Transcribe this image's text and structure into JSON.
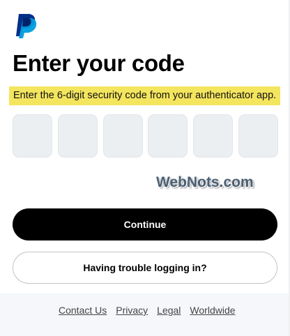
{
  "brand": {
    "logo_icon": "paypal-logo-icon",
    "colors": {
      "primary": "#003087",
      "secondary": "#009cde",
      "highlight": "#f4e55e"
    }
  },
  "heading": {
    "title": "Enter your code",
    "subtitle": "Enter the 6-digit security code from your authenticator app."
  },
  "code_inputs": [
    {
      "value": ""
    },
    {
      "value": ""
    },
    {
      "value": ""
    },
    {
      "value": ""
    },
    {
      "value": ""
    },
    {
      "value": ""
    }
  ],
  "watermark": "WebNots.com",
  "actions": {
    "continue_label": "Continue",
    "trouble_label": "Having trouble logging in?"
  },
  "footer": {
    "links": [
      "Contact Us",
      "Privacy",
      "Legal",
      "Worldwide"
    ]
  }
}
